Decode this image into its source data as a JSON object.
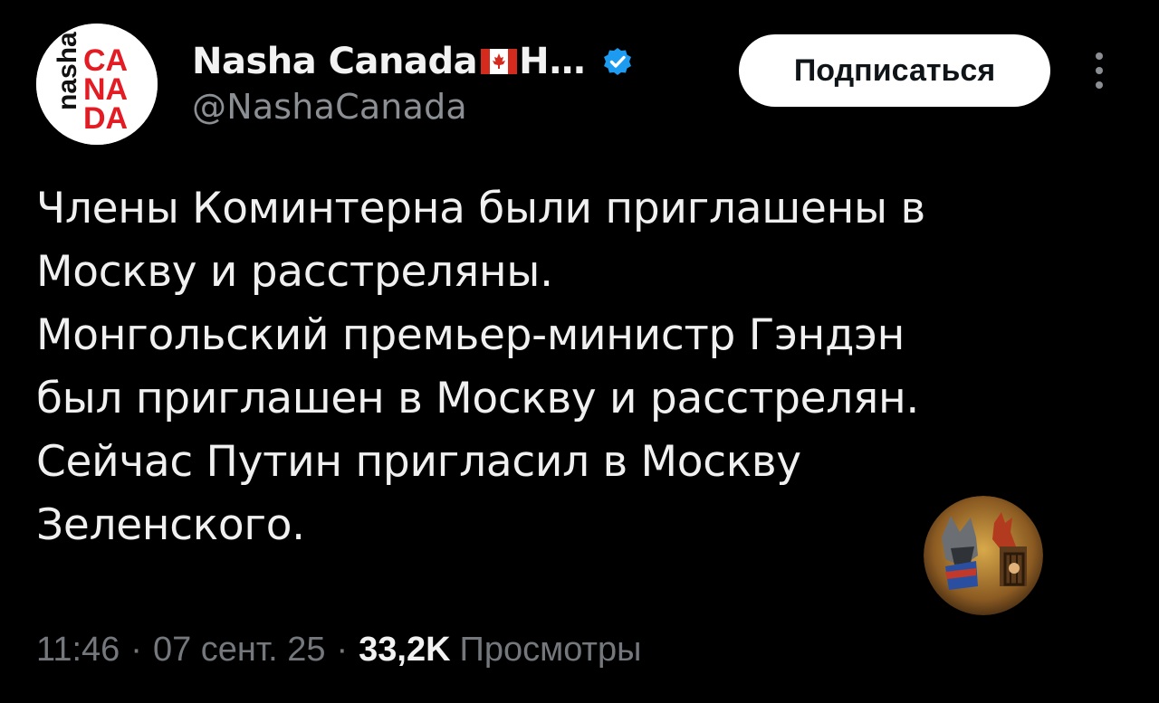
{
  "account": {
    "display_name": "Nasha Canada",
    "display_name_tail": "H…",
    "handle": "@NashaCanada",
    "verified": true,
    "avatar_text": {
      "side": "nasha",
      "rows": [
        "CA",
        "NA",
        "DA"
      ]
    }
  },
  "actions": {
    "subscribe_label": "Подписаться"
  },
  "tweet": {
    "lines": [
      "Члены Коминтерна были приглашены в",
      "Москву и расстреляны.",
      "Монгольский премьер-министр Гэндэн",
      "был приглашен в Москву и расстрелян.",
      "Сейчас Путин пригласил в Москву",
      "Зеленского."
    ]
  },
  "meta": {
    "time": "11:46",
    "date": "07 сент. 25",
    "separator": "·",
    "views_count": "33,2K",
    "views_label": "Просмотры"
  },
  "colors": {
    "background": "#000000",
    "text": "#f0f0f0",
    "muted": "#74787d",
    "handle": "#8b8f94",
    "verified": "#1d9bf0",
    "brand_red": "#e31b23"
  },
  "icons": [
    "canada-flag-icon",
    "verified-badge-icon",
    "more-vertical-icon"
  ]
}
